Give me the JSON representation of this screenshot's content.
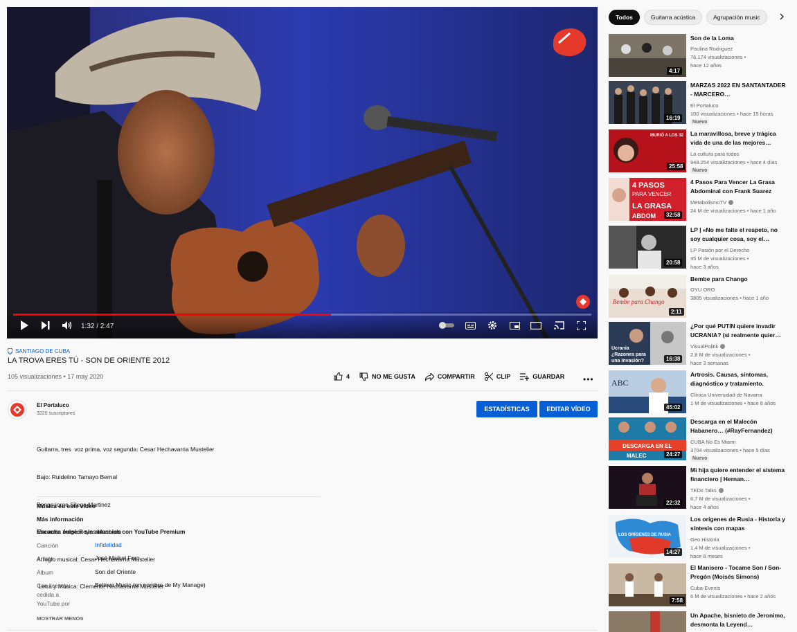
{
  "player": {
    "time": "1:32 / 2:47",
    "progress": 0.55
  },
  "video": {
    "location": "SANTIAGO DE CUBA",
    "title": "LA TROVA ERES TÚ - SON DE ORIENTE 2012",
    "stats": "105 visualizaciones • 17 may 2020",
    "likes": "4",
    "dislike_label": "NO ME GUSTA",
    "share_label": "COMPARTIR",
    "clip_label": "CLIP",
    "save_label": "GUARDAR",
    "more_label": "•••"
  },
  "channel": {
    "name": "El Portaluco",
    "subscribers": "3220 suscriptores",
    "stats_button": "ESTADÍSTICAS",
    "edit_button": "EDITAR VÍDEO"
  },
  "description": [
    "Guitarra, tres  voz prima, voz segunda: Cesar Hechavarria Mustelier",
    "Bajo: Ruidelino Tamayo Bernal",
    "Bongo:jorge Silega Martinez",
    "Maracas: Jorge Reyes Machado",
    "Arreglo musical: Cesar Hechavarria Mustelier",
    " Letra y Música: Clemente Hechavarria Mustelier"
  ],
  "music": {
    "heading": "Música en este vídeo",
    "more_info": "Más información",
    "premium": "Escucha música sin anuncios con YouTube Premium",
    "song_label": "Canción",
    "song_value": "Infidelidad",
    "artist_label": "Artista",
    "artist_value": "José Maikel Fero",
    "album_label": "Álbum",
    "album_value": "Son del Oriente",
    "license_label": "Con licencia cedida a YouTube por",
    "license_value": "Believe Music (en nombre de My Manage)",
    "show_less": "MOSTRAR MENOS"
  },
  "chips": [
    "Todos",
    "Guitarra acústica",
    "Agrupación music"
  ],
  "recommendations": [
    {
      "title": "Son de la Loma",
      "channel": "Paulina Rodriguez",
      "views": "76.174 visualizaciones •",
      "age": "hace 12 años",
      "duration": "4:17",
      "verified": false,
      "new": false
    },
    {
      "title": "MARZAS 2022 EN SANTANTADER - MARCERO…",
      "channel": "El Portaluco",
      "views": "100 visualizaciones • hace 15 horas",
      "age": "",
      "duration": "16:19",
      "verified": false,
      "new": true
    },
    {
      "title": "La maravillosa, breve y trágica vida de una de las mejores…",
      "channel": "La cultura para todos",
      "views": "948.254 visualizaciones • hace 4 días",
      "age": "",
      "duration": "25:58",
      "verified": false,
      "new": true
    },
    {
      "title": "4 Pasos Para Vencer La Grasa Abdominal con Frank Suarez",
      "channel": "MetabolismoTV",
      "views": "24 M de visualizaciones • hace 1 año",
      "age": "",
      "duration": "32:58",
      "verified": true,
      "new": false
    },
    {
      "title": "LP | «No me falte el respeto, no soy cualquier cosa, soy el…",
      "channel": "LP Pasión por el Derecho",
      "views": "35 M de visualizaciones •",
      "age": "hace 3 años",
      "duration": "20:58",
      "verified": false,
      "new": false
    },
    {
      "title": "Bembe para Chango",
      "channel": "OYU ORO",
      "views": "3805 visualizaciones • hace 1 año",
      "age": "",
      "duration": "2:11",
      "verified": false,
      "new": false
    },
    {
      "title": "¿Por qué PUTIN quiere invadir UCRANIA? (si realmente quier…",
      "channel": "VisualPolitik",
      "views": "2,8 M de visualizaciones •",
      "age": "hace 3 semanas",
      "duration": "16:38",
      "verified": true,
      "new": false
    },
    {
      "title": "Artrosis. Causas, síntomas, diagnóstico y tratamiento.",
      "channel": "Clínica Universidad de Navarra",
      "views": "1 M de visualizaciones • hace 8 años",
      "age": "",
      "duration": "45:02",
      "verified": false,
      "new": false
    },
    {
      "title": "Descarga en el Malecón Habanero… (#RayFernandez)",
      "channel": "CUBA No Es Miami",
      "views": "3704 visualizaciones • hace 5 días",
      "age": "",
      "duration": "24:27",
      "verified": false,
      "new": true
    },
    {
      "title": "Mi hija quiere entender el sistema financiero | Hernan…",
      "channel": "TEDx Talks",
      "views": "6,7 M de visualizaciones •",
      "age": "hace 4 años",
      "duration": "22:32",
      "verified": true,
      "new": false
    },
    {
      "title": "Los orígenes de Rusia - Historia y síntesis con mapas",
      "channel": "Geo Historia",
      "views": "1,4 M de visualizaciones •",
      "age": "hace 8 meses",
      "duration": "14:27",
      "verified": false,
      "new": false
    },
    {
      "title": "El Manisero - Tocame Son / Son-Pregón (Moisés Simons)",
      "channel": "Cuba-Events",
      "views": "6 M de visualizaciones • hace 2 años",
      "age": "",
      "duration": "7:58",
      "verified": false,
      "new": false
    },
    {
      "title": "Un Apache, bisnieto de Jeronimo, desmonta la Leyend…",
      "channel": "",
      "views": "",
      "age": "",
      "duration": "",
      "verified": false,
      "new": false
    }
  ],
  "thumb_text": {
    "t3": "MURIÓ A LOS 32",
    "t4a": "4 PASOS",
    "t4b": "PARA VENCER",
    "t4c": "LA GRASA",
    "t4d": "ABDOM",
    "t6": "Bembe para Chango",
    "t7a": "Ucrania",
    "t7b": "¿Razones para",
    "t7c": "una invasión?",
    "t8": "ABC",
    "t9a": "DESCARGA EN EL",
    "t9b": "MALEC",
    "t11": "LOS ORÍGENES DE RUSIA"
  },
  "colors": {
    "accent": "#065fd4",
    "progress": "#ff0000",
    "brand": "#e53a2b"
  }
}
